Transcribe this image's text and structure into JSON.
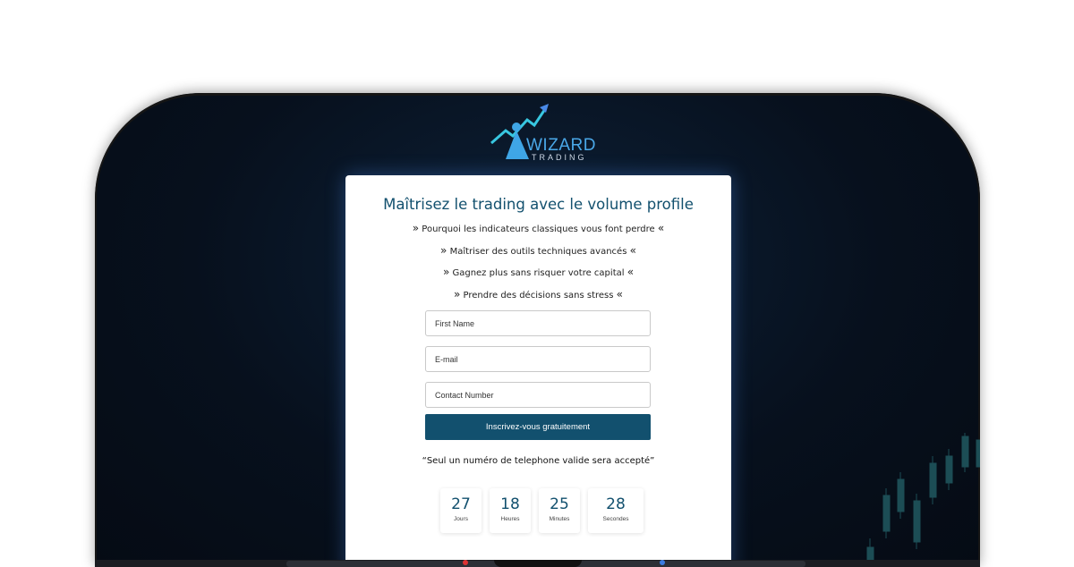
{
  "brand": {
    "name": "WIZARD",
    "tagline": "TRADING"
  },
  "card": {
    "title": "Maîtrisez le trading avec le volume profile",
    "bullets": [
      "Pourquoi les indicateurs classiques vous font perdre",
      "Maîtriser des outils techniques avancés",
      "Gagnez plus sans risquer votre capital",
      "Prendre des décisions sans stress"
    ],
    "bullet_open": "»",
    "bullet_close": "«"
  },
  "form": {
    "first_name_placeholder": "First Name",
    "email_placeholder": "E-mail",
    "phone_placeholder": "Contact Number",
    "submit_label": "Inscrivez-vous gratuitement"
  },
  "note": "“Seul un numéro de telephone valide sera accepté”",
  "countdown": [
    {
      "value": "27",
      "label": "Jours"
    },
    {
      "value": "18",
      "label": "Heures"
    },
    {
      "value": "25",
      "label": "Minutes"
    },
    {
      "value": "28",
      "label": "Secondes"
    }
  ],
  "colors": {
    "primary": "#12506e",
    "background": "#07101d",
    "accent": "#4aa8e8"
  }
}
